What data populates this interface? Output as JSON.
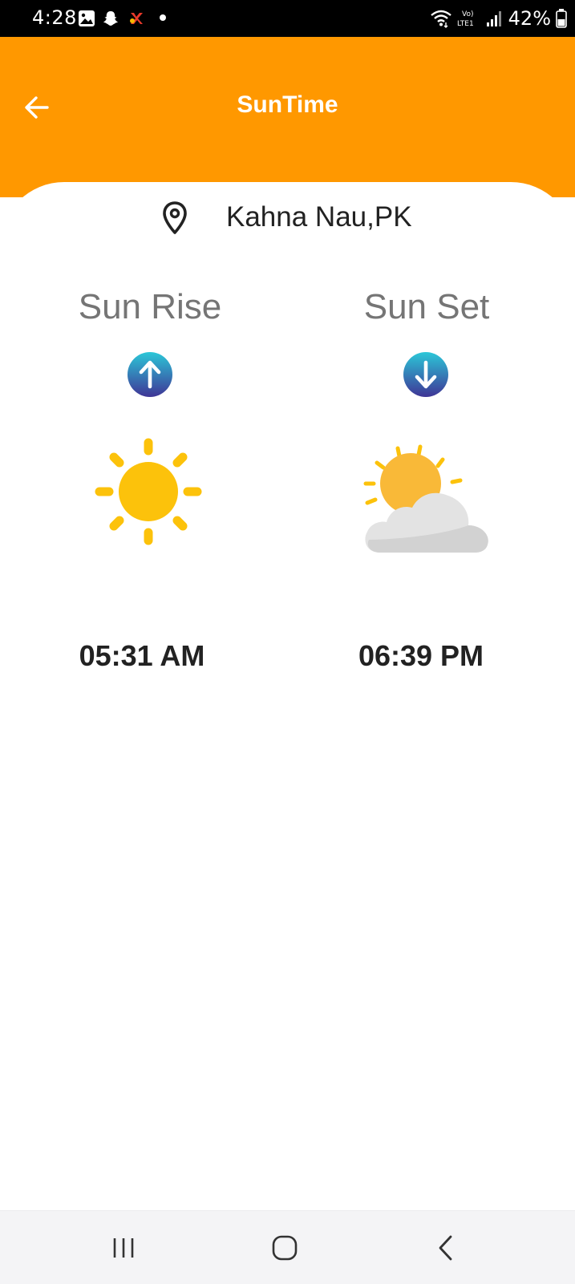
{
  "status_bar": {
    "time": "4:28",
    "battery": "42%",
    "network": "Vo) LTE1"
  },
  "app_bar": {
    "title": "SunTime"
  },
  "location": {
    "name": "Kahna Nau,PK"
  },
  "sunrise": {
    "label": "Sun Rise",
    "time": "05:31 AM"
  },
  "sunset": {
    "label": "Sun Set",
    "time": "06:39 PM"
  },
  "colors": {
    "accent": "#ff9800",
    "sun": "#fcc20b",
    "badge_top": "#2bc7d8",
    "badge_bottom": "#3f3596"
  },
  "icons": [
    "back-arrow-icon",
    "location-pin-icon",
    "arrow-up-icon",
    "arrow-down-icon",
    "sun-icon",
    "sun-cloud-icon",
    "recent-apps-icon",
    "home-icon",
    "back-icon"
  ]
}
